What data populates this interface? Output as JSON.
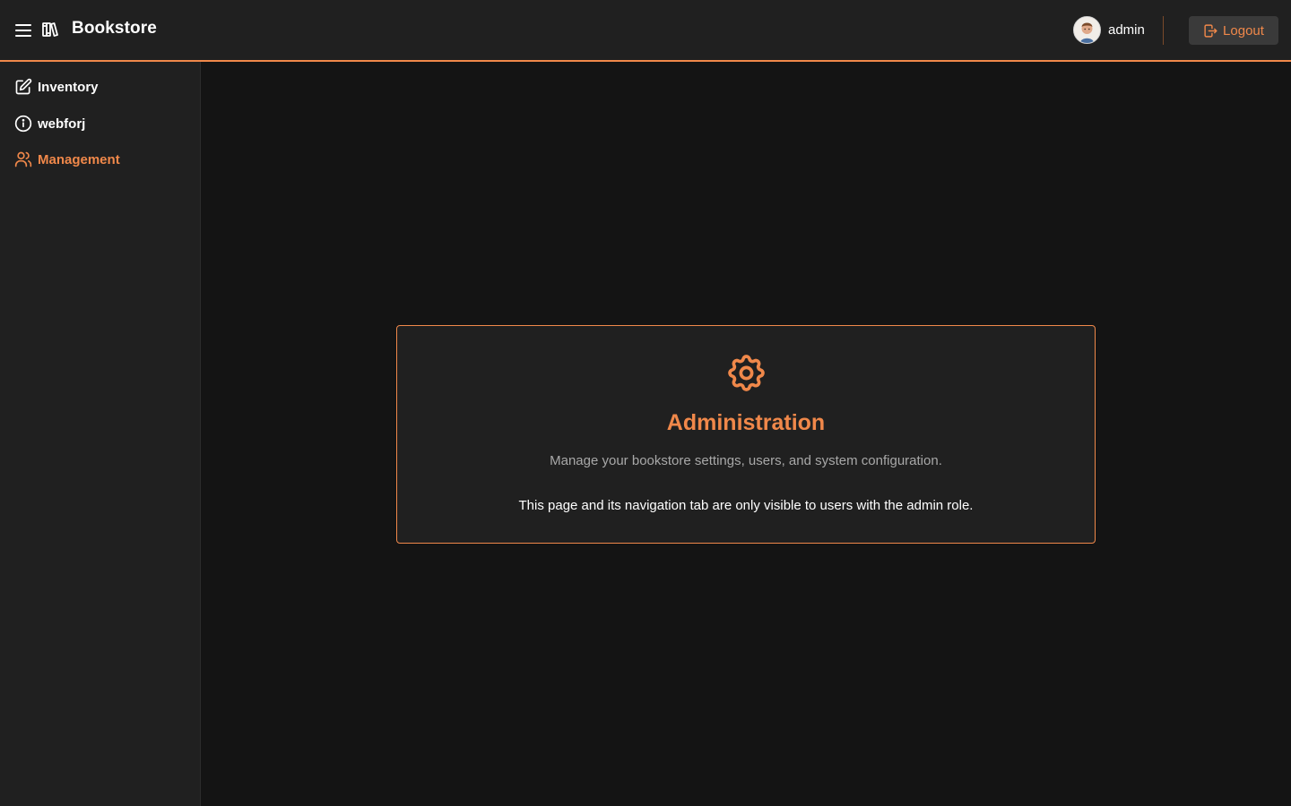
{
  "header": {
    "menu_icon": "hamburger-menu-icon",
    "logo_icon": "books-icon",
    "title": "Bookstore",
    "user": {
      "name": "admin",
      "avatar_icon": "user-avatar"
    },
    "logout_label": "Logout",
    "logout_icon": "logout-icon"
  },
  "sidebar": {
    "items": [
      {
        "label": "Inventory",
        "icon": "edit-icon",
        "active": false
      },
      {
        "label": "webforj",
        "icon": "info-icon",
        "active": false
      },
      {
        "label": "Management",
        "icon": "users-icon",
        "active": true
      }
    ]
  },
  "main": {
    "card": {
      "icon": "gear-icon",
      "title": "Administration",
      "subtitle": "Manage your bookstore settings, users, and system configuration.",
      "note": "This page and its navigation tab are only visible to users with the admin role."
    }
  },
  "colors": {
    "accent": "#f0884a",
    "background": "#141414",
    "surface": "#202020",
    "muted_text": "#a8a8a8"
  }
}
